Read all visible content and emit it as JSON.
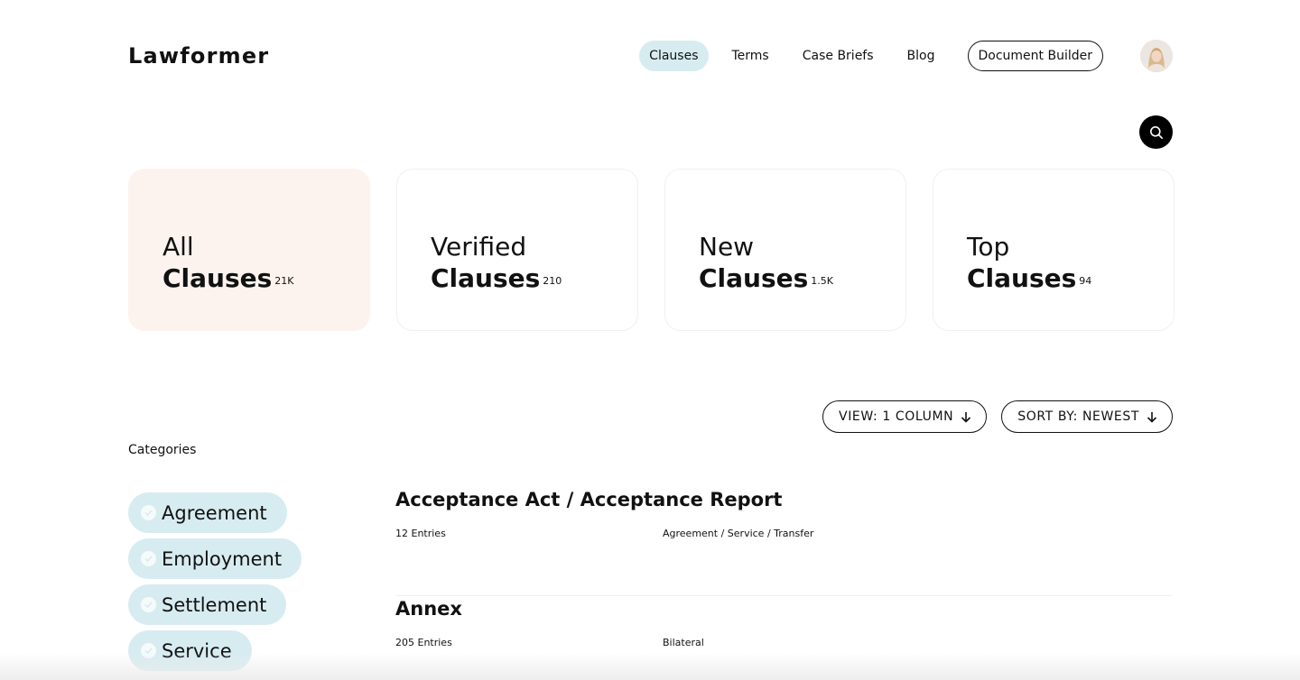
{
  "header": {
    "logo": "Lawformer",
    "nav": [
      {
        "label": "Clauses",
        "active": true
      },
      {
        "label": "Terms",
        "active": false
      },
      {
        "label": "Case Briefs",
        "active": false
      },
      {
        "label": "Blog",
        "active": false
      }
    ],
    "cta_label": "Document Builder",
    "avatar_icon": "user-avatar"
  },
  "search": {
    "icon": "search-icon"
  },
  "cards": [
    {
      "top": "All",
      "bottom": "Clauses",
      "count": "21K",
      "active": true
    },
    {
      "top": "Verified",
      "bottom": "Clauses",
      "count": "210",
      "active": false
    },
    {
      "top": "New",
      "bottom": "Clauses",
      "count": "1.5K",
      "active": false
    },
    {
      "top": "Top",
      "bottom": "Clauses",
      "count": "94",
      "active": false
    }
  ],
  "toolbar": {
    "view_label": "VIEW: 1 COLUMN",
    "sort_label": "SORT BY: NEWEST",
    "arrow_icon": "arrow-down-icon"
  },
  "categories": {
    "heading": "Categories",
    "items": [
      "Agreement",
      "Employment",
      "Settlement",
      "Service"
    ]
  },
  "clauses": [
    {
      "title": "Acceptance Act / Acceptance Report",
      "entries": "12 Entries",
      "tags": "Agreement / Service / Transfer"
    },
    {
      "title": "Annex",
      "entries": "205 Entries",
      "tags": "Bilateral"
    }
  ],
  "colors": {
    "accent_blue": "#d7ecf1",
    "card_active": "#fcf3ee",
    "text": "#111111"
  }
}
